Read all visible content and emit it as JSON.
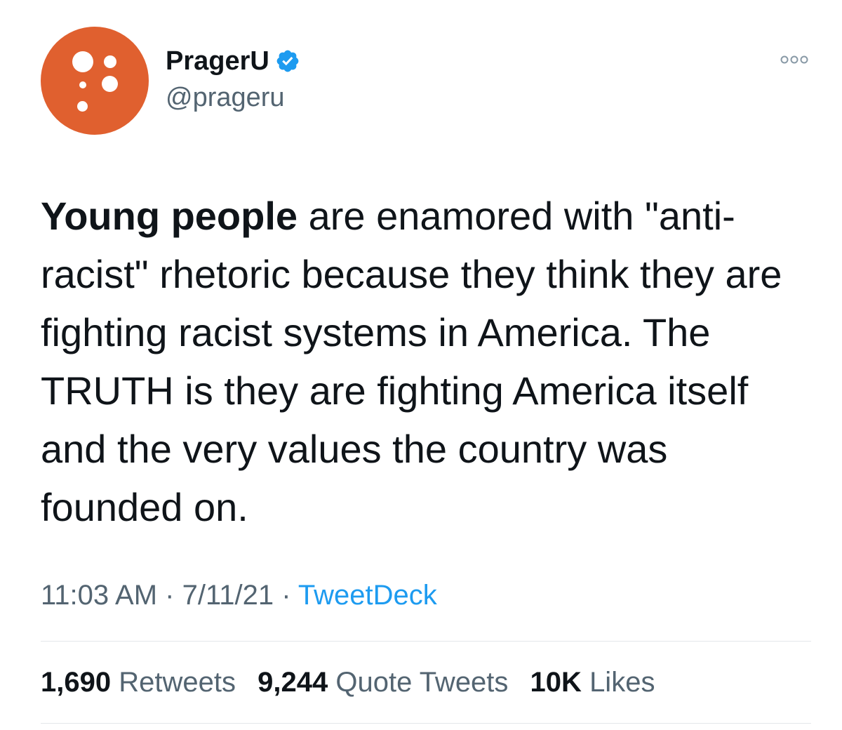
{
  "author": {
    "display_name": "PragerU",
    "handle": "@prageru",
    "verified": true,
    "avatar_color": "#e0602f",
    "verified_color": "#1d9bf0"
  },
  "tweet": {
    "bold_lead": "Young people",
    "text": " are enamored with \"anti-racist\" rhetoric because they think they are fighting racist systems in America. The TRUTH is they are fighting America itself and the very values the country was founded on."
  },
  "meta": {
    "time": "11:03 AM",
    "separator": " · ",
    "date": "7/11/21",
    "source": "TweetDeck"
  },
  "stats": {
    "retweets_count": "1,690",
    "retweets_label": "Retweets",
    "quotes_count": "9,244",
    "quotes_label": "Quote Tweets",
    "likes_count": "10K",
    "likes_label": "Likes"
  },
  "icons": {
    "more": "more-options-icon",
    "verified": "verified-badge-icon"
  }
}
